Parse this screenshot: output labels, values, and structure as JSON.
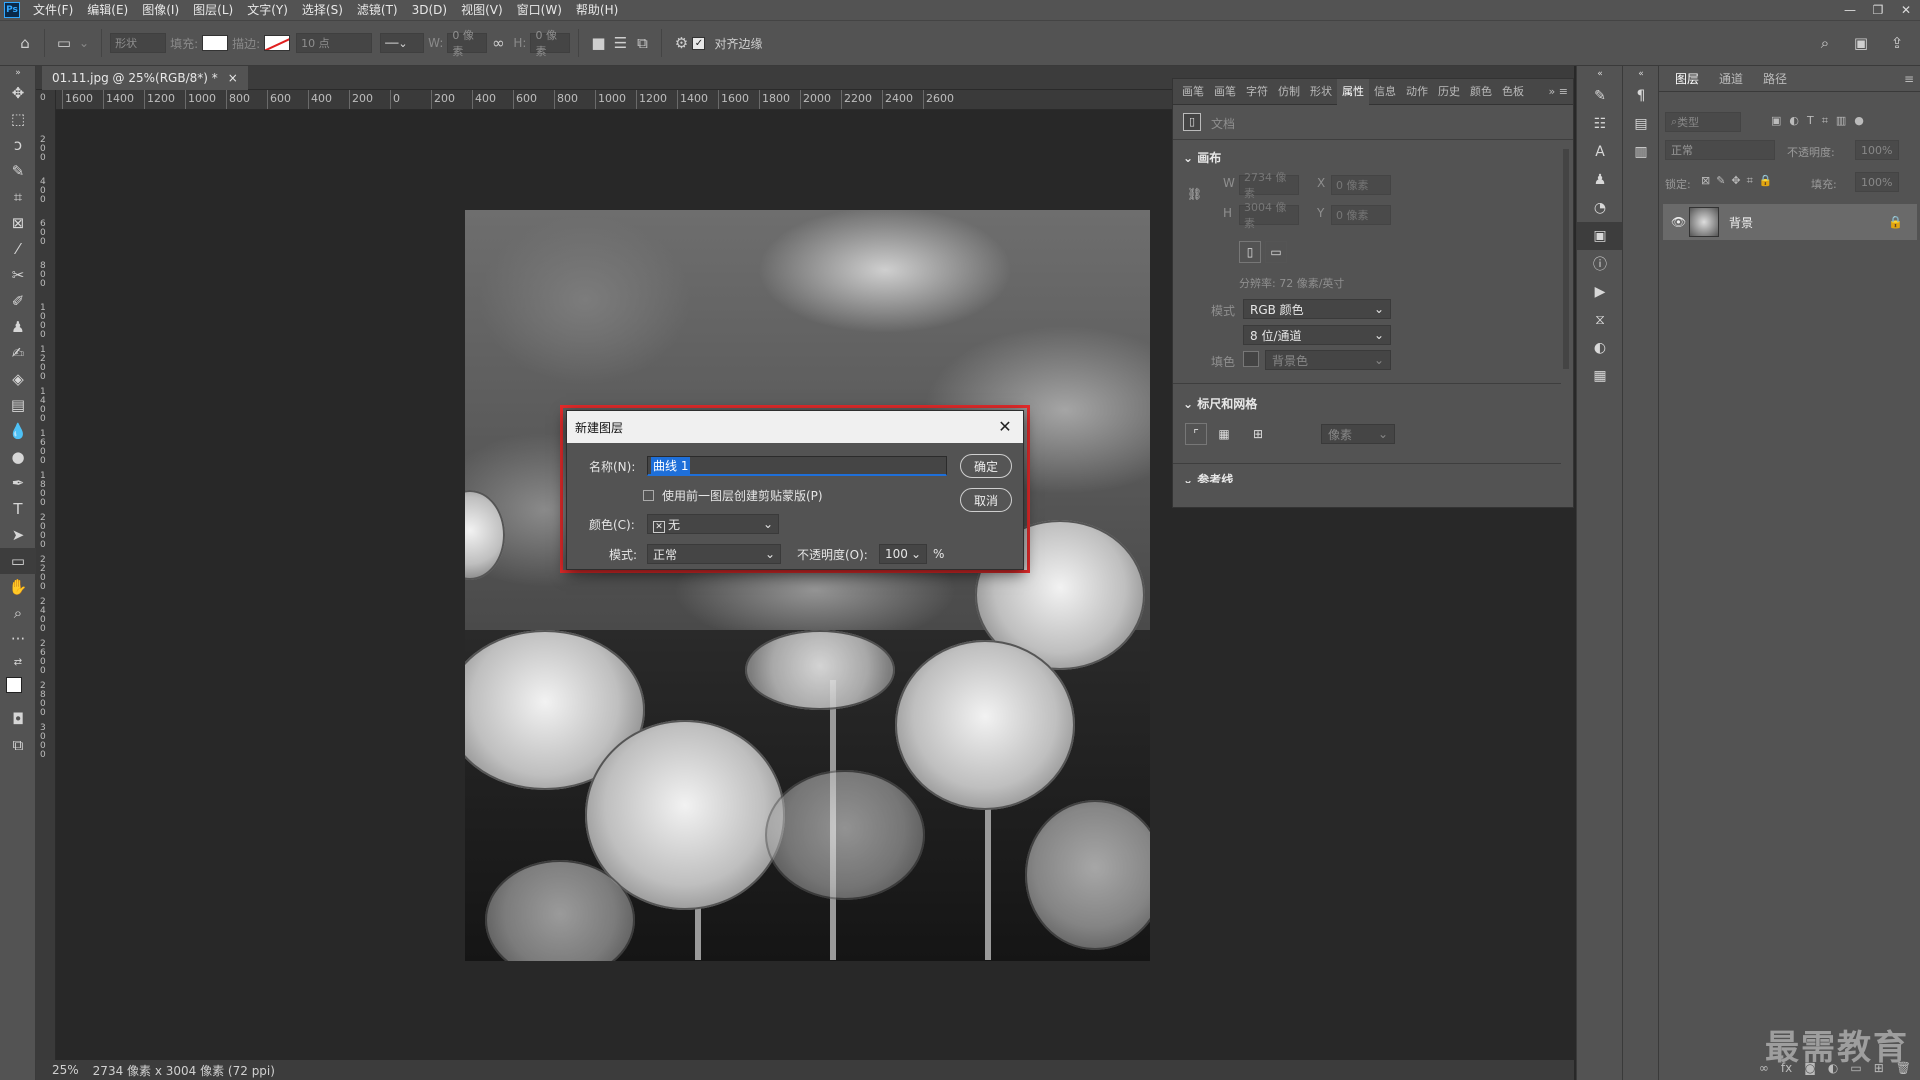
{
  "app": {
    "logo": "Ps"
  },
  "menu": [
    "文件(F)",
    "编辑(E)",
    "图像(I)",
    "图层(L)",
    "文字(Y)",
    "选择(S)",
    "滤镜(T)",
    "3D(D)",
    "视图(V)",
    "窗口(W)",
    "帮助(H)"
  ],
  "window_controls": [
    "—",
    "❐",
    "✕"
  ],
  "options": {
    "shape_mode": "形状",
    "fill_label": "填充:",
    "stroke_label": "描边:",
    "stroke_size": "10 点",
    "w_label": "W:",
    "w_value": "0 像素",
    "h_label": "H:",
    "h_value": "0 像素",
    "align_edges": "对齐边缘"
  },
  "document": {
    "tab_title": "01.11.jpg @ 25%(RGB/8*) *",
    "tab_close": "×"
  },
  "ruler": {
    "h_ticks": [
      "1600",
      "1400",
      "1200",
      "1000",
      "800",
      "600",
      "400",
      "200",
      "0",
      "200",
      "400",
      "600",
      "800",
      "1000",
      "1200",
      "1400",
      "1600",
      "1800",
      "2000",
      "2200",
      "2400",
      "2600"
    ],
    "v_ticks": [
      "0",
      "200",
      "400",
      "600",
      "800",
      "1000",
      "1200",
      "1400",
      "1600",
      "1800",
      "2000",
      "2200",
      "2400",
      "2600",
      "2800",
      "3000"
    ]
  },
  "dialog": {
    "title": "新建图层",
    "name_label": "名称(N):",
    "name_value": "曲线 1",
    "clip_label": "使用前一图层创建剪贴蒙版(P)",
    "color_label": "颜色(C):",
    "color_value": "无",
    "mode_label": "模式:",
    "mode_value": "正常",
    "opacity_label": "不透明度(O):",
    "opacity_value": "100",
    "opacity_unit": "%",
    "ok": "确定",
    "cancel": "取消"
  },
  "properties": {
    "tabs": [
      "画笔",
      "画笔",
      "字符",
      "仿制",
      "形状",
      "属性",
      "信息",
      "动作",
      "历史",
      "颜色",
      "色板"
    ],
    "active_tab": "属性",
    "doc_label": "文档",
    "canvas_header": "画布",
    "w_label": "W",
    "w_value": "2734 像素",
    "x_label": "X",
    "x_value": "0 像素",
    "h_label": "H",
    "h_value": "3004 像素",
    "y_label": "Y",
    "y_value": "0 像素",
    "resolution": "分辨率: 72 像素/英寸",
    "mode_label": "模式",
    "mode_value": "RGB 颜色",
    "depth_value": "8 位/通道",
    "fill_label": "填色",
    "fill_value": "背景色",
    "rulers_header": "标尺和网格",
    "ruler_unit": "像素",
    "guides_header": "参考线"
  },
  "layers": {
    "tabs": [
      "图层",
      "通道",
      "路径"
    ],
    "filter_placeholder": "类型",
    "blend_mode": "正常",
    "opacity_label": "不透明度:",
    "opacity_value": "100%",
    "lock_label": "锁定:",
    "fill_label": "填充:",
    "fill_value": "100%",
    "layer_name": "背景"
  },
  "status": {
    "zoom": "25%",
    "info": "2734 像素 x 3004 像素 (72 ppi)"
  },
  "watermark": "最需教育"
}
